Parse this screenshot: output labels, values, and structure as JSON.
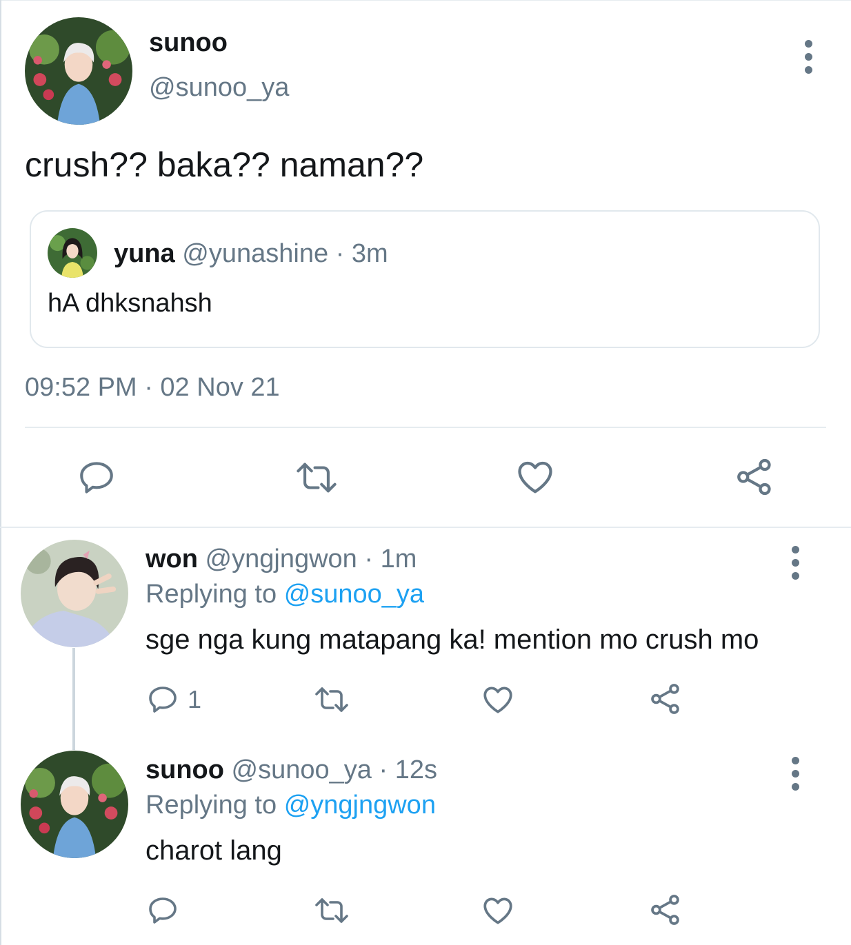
{
  "main_tweet": {
    "author_name": "sunoo",
    "author_handle": "@sunoo_ya",
    "text": "crush?? baka?? naman??",
    "timestamp": "09:52 PM · 02 Nov 21",
    "quoted": {
      "author_name": "yuna",
      "author_handle": "@yunashine",
      "time": "· 3m",
      "text": "hA dhksnahsh"
    },
    "actions": [
      "reply-icon",
      "retweet-icon",
      "like-icon",
      "share-icon"
    ]
  },
  "replies": [
    {
      "author_name": "won",
      "author_handle": "@yngjngwon",
      "time": "· 1m",
      "replying_prefix": "Replying to",
      "replying_to": "@sunoo_ya",
      "text": "sge nga kung matapang ka! mention mo crush mo",
      "reply_count": "1"
    },
    {
      "author_name": "sunoo",
      "author_handle": "@sunoo_ya",
      "time": "· 12s",
      "replying_prefix": "Replying to",
      "replying_to": "@yngjngwon",
      "text": "charot lang",
      "reply_count": ""
    }
  ],
  "colors": {
    "accent": "#1da1f2",
    "muted": "#657786",
    "text": "#14171a",
    "border": "#e1e8ed"
  }
}
